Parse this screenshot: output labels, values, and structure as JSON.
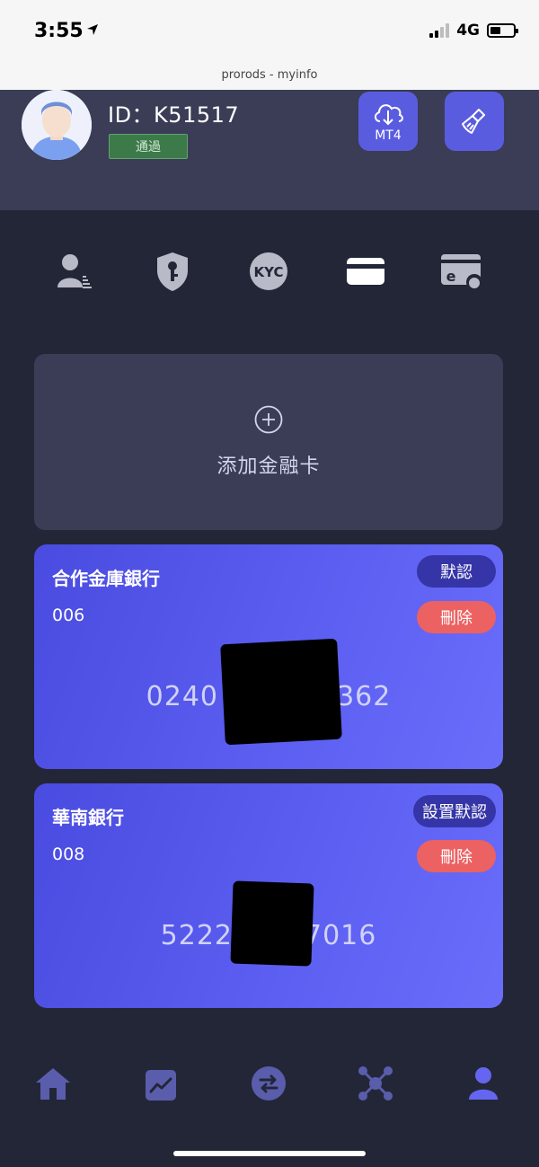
{
  "status_bar": {
    "time": "3:55",
    "network": "4G"
  },
  "browser": {
    "url_title": "prorods - myinfo"
  },
  "profile": {
    "id_text": "ID：K51517",
    "status_badge": "通過",
    "mt4_label": "MT4"
  },
  "tabs": [
    {
      "icon": "user-profile-icon"
    },
    {
      "icon": "security-key-icon"
    },
    {
      "icon": "kyc-icon",
      "label": "KYC"
    },
    {
      "icon": "bank-card-icon",
      "active": true
    },
    {
      "icon": "e-wallet-icon"
    }
  ],
  "add_card": {
    "label": "添加金融卡"
  },
  "cards": [
    {
      "bank_name": "合作金庫銀行",
      "bank_code": "006",
      "number_start": "0240",
      "number_end": "1362",
      "default_label": "默認",
      "delete_label": "刪除"
    },
    {
      "bank_name": "華南銀行",
      "bank_code": "008",
      "number_start": "5222",
      "number_end": "7016",
      "default_label": "設置默認",
      "delete_label": "刪除"
    }
  ],
  "colors": {
    "background": "#232637",
    "panel": "#3a3d55",
    "accent": "#5a5ce0",
    "delete": "#ec6161",
    "success": "#3d7a4a"
  }
}
